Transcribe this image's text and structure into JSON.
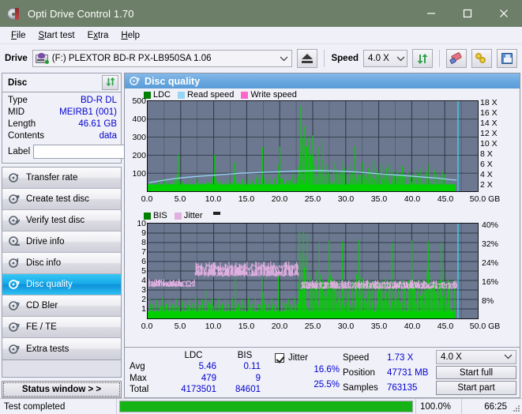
{
  "window": {
    "title": "Opti Drive Control 1.70",
    "app_icon": "disc-icon",
    "minimize": "–",
    "maximize": "□",
    "close": "✕",
    "titlebar_color": "#6d7f68"
  },
  "menu": [
    {
      "label": "File",
      "accel": "F"
    },
    {
      "label": "Start test",
      "accel": "S"
    },
    {
      "label": "Extra",
      "accel": "x"
    },
    {
      "label": "Help",
      "accel": "H"
    }
  ],
  "toolbar": {
    "drive_label": "Drive",
    "drive_value": "(F:)   PLEXTOR BD-R  PX-LB950SA 1.06",
    "eject_icon": "eject-icon",
    "speed_label": "Speed",
    "speed_value": "4.0 X",
    "refresh_icon": "refresh-icon",
    "erase_icon": "eraser-icon",
    "keys_icon": "keys-icon",
    "save_icon": "floppy-save-icon"
  },
  "disc_panel": {
    "title": "Disc",
    "refresh_icon": "refresh-icon",
    "rows": [
      {
        "key": "Type",
        "value": "BD-R DL"
      },
      {
        "key": "MID",
        "value": "MEIRB1 (001)"
      },
      {
        "key": "Length",
        "value": "46.61 GB"
      },
      {
        "key": "Contents",
        "value": "data"
      }
    ],
    "label_key": "Label",
    "label_value": "",
    "label_placeholder": "",
    "disc_icon": "cd-icon"
  },
  "nav": {
    "items": [
      {
        "label": "Transfer rate",
        "icon": "disc-test-icon",
        "active": false
      },
      {
        "label": "Create test disc",
        "icon": "disc-burn-icon",
        "active": false
      },
      {
        "label": "Verify test disc",
        "icon": "disc-verify-icon",
        "active": false
      },
      {
        "label": "Drive info",
        "icon": "drive-info-icon",
        "active": false
      },
      {
        "label": "Disc info",
        "icon": "disc-info-icon",
        "active": false
      },
      {
        "label": "Disc quality",
        "icon": "disc-quality-icon",
        "active": true
      },
      {
        "label": "CD Bler",
        "icon": "cd-bler-icon",
        "active": false
      },
      {
        "label": "FE / TE",
        "icon": "fe-te-icon",
        "active": false
      },
      {
        "label": "Extra tests",
        "icon": "extra-tests-icon",
        "active": false
      }
    ],
    "status_button": "Status window > >"
  },
  "main": {
    "title": "Disc quality",
    "title_icon": "disc-quality-icon"
  },
  "stats": {
    "col_headers": [
      "LDC",
      "BIS"
    ],
    "rows": [
      {
        "label": "Avg",
        "ldc": "5.46",
        "bis": "0.11"
      },
      {
        "label": "Max",
        "ldc": "479",
        "bis": "9"
      },
      {
        "label": "Total",
        "ldc": "4173501",
        "bis": "84601"
      }
    ],
    "jitter": {
      "label": "Jitter",
      "checked": true,
      "avg": "16.6%",
      "max": "25.5%"
    },
    "speed_label": "Speed",
    "speed_value": "1.73 X",
    "position_label": "Position",
    "position_value": "47731 MB",
    "samples_label": "Samples",
    "samples_value": "763135",
    "select_speed": "4.0 X",
    "start_full": "Start full",
    "start_part": "Start part"
  },
  "statusbar": {
    "message": "Test completed",
    "progress_percent": 100.0,
    "progress_text": "100.0%",
    "elapsed": "66:25"
  },
  "chart_data": [
    {
      "id": "top-chart",
      "type": "line",
      "title": "",
      "xlabel": "GB",
      "ylabel": "LDC",
      "y2label": "X",
      "xlim": [
        0,
        50
      ],
      "ylim": [
        0,
        500
      ],
      "y2lim": [
        0,
        18
      ],
      "grid": true,
      "legend_position": "top-left",
      "legend": [
        {
          "name": "LDC",
          "color": "#008000"
        },
        {
          "name": "Read speed",
          "color": "#97d5f2"
        },
        {
          "name": "Write speed",
          "color": "#ff66cc"
        }
      ],
      "xticks": [
        "0.0",
        "5.0",
        "10.0",
        "15.0",
        "20.0",
        "25.0",
        "30.0",
        "35.0",
        "40.0",
        "45.0",
        "50.0 GB"
      ],
      "yticks": [
        100,
        200,
        300,
        400,
        500
      ],
      "y2ticks": [
        "2 X",
        "4 X",
        "6 X",
        "8 X",
        "10 X",
        "12 X",
        "14 X",
        "16 X",
        "18 X"
      ],
      "series": [
        {
          "name": "LDC",
          "color": "#00d000",
          "kind": "spikes",
          "x": [
            0.2,
            0.6,
            1.1,
            1.6,
            2.1,
            2.6,
            3.1,
            3.6,
            4.1,
            4.6,
            4.9,
            5.3,
            5.8,
            6.3,
            6.8,
            7.3,
            7.8,
            8.3,
            8.8,
            9.3,
            9.8,
            10.1,
            10.6,
            11.1,
            11.6,
            12.1,
            12.6,
            13.1,
            13.6,
            13.9,
            14.4,
            14.9,
            15.4,
            15.9,
            16.4,
            16.9,
            17.4,
            17.7,
            18.2,
            18.7,
            19.2,
            19.7,
            20.0,
            20.4,
            20.9,
            21.4,
            21.9,
            22.4,
            22.9,
            23.2,
            23.5,
            23.8,
            24.1,
            24.4,
            24.7,
            25.0,
            25.4,
            25.8,
            26.2,
            26.6,
            27.0,
            27.4,
            27.8,
            28.2,
            28.6,
            29.0,
            29.4,
            29.8,
            30.2,
            30.6,
            31.0,
            31.4,
            31.8,
            32.2,
            32.6,
            33.0,
            33.4,
            33.8,
            34.2,
            34.6,
            35.0,
            35.4,
            35.8,
            36.2,
            36.6,
            37.0,
            37.4,
            37.8,
            38.2,
            38.6,
            39.0,
            39.4,
            39.8,
            40.2,
            40.6,
            41.0,
            41.4,
            41.8,
            42.2,
            42.6,
            43.0,
            43.4,
            43.8,
            44.2,
            44.6,
            45.0,
            45.4,
            45.8,
            46.2,
            46.6
          ],
          "y": [
            40,
            55,
            35,
            60,
            45,
            70,
            50,
            40,
            65,
            205,
            48,
            55,
            42,
            60,
            38,
            70,
            52,
            44,
            60,
            48,
            75,
            203,
            55,
            60,
            45,
            70,
            50,
            160,
            62,
            48,
            70,
            55,
            80,
            60,
            90,
            70,
            245,
            75,
            60,
            88,
            70,
            95,
            248,
            70,
            85,
            60,
            95,
            75,
            140,
            470,
            300,
            360,
            250,
            300,
            200,
            310,
            180,
            250,
            120,
            290,
            150,
            110,
            95,
            160,
            120,
            100,
            170,
            130,
            90,
            150,
            110,
            250,
            120,
            90,
            160,
            100,
            130,
            110,
            170,
            120,
            100,
            150,
            95,
            130,
            160,
            110,
            95,
            120,
            100,
            140,
            90,
            110,
            85,
            95,
            120,
            100,
            130,
            90,
            110,
            150,
            95,
            120,
            100,
            85,
            110,
            95,
            60,
            50,
            40,
            30
          ]
        },
        {
          "name": "Read speed",
          "color": "#97d5f2",
          "kind": "line",
          "x": [
            0.2,
            2.0,
            4.0,
            6.0,
            8.0,
            10.0,
            12.0,
            14.0,
            16.0,
            18.0,
            20.0,
            22.0,
            24.0,
            26.0,
            28.0,
            30.0,
            32.0,
            34.0,
            36.0,
            38.0,
            40.0,
            42.0,
            44.0,
            46.0,
            46.8
          ],
          "y_in_x": [
            1.7,
            2.1,
            2.5,
            2.8,
            3.0,
            3.2,
            3.4,
            3.6,
            3.7,
            3.8,
            3.9,
            4.0,
            4.05,
            4.1,
            4.05,
            3.95,
            3.8,
            3.6,
            3.4,
            3.2,
            3.0,
            2.8,
            2.6,
            2.3,
            2.2
          ]
        },
        {
          "name": "Write speed",
          "color": "#ff66cc",
          "kind": "line",
          "x": [],
          "y": []
        },
        {
          "name": "cursor",
          "color": "#35d2f2",
          "kind": "vline",
          "x": 47.0
        }
      ]
    },
    {
      "id": "bottom-chart",
      "type": "line",
      "title": "",
      "xlabel": "GB",
      "ylabel": "BIS",
      "y2label": "%",
      "xlim": [
        0,
        50
      ],
      "ylim": [
        0,
        10
      ],
      "y2lim": [
        0,
        40
      ],
      "grid": true,
      "legend_position": "top-left",
      "legend": [
        {
          "name": "BIS",
          "color": "#008000"
        },
        {
          "name": "Jitter",
          "color": "#e0afe0"
        }
      ],
      "xticks": [
        "0.0",
        "5.0",
        "10.0",
        "15.0",
        "20.0",
        "25.0",
        "30.0",
        "35.0",
        "40.0",
        "45.0",
        "50.0 GB"
      ],
      "yticks": [
        1,
        2,
        3,
        4,
        5,
        6,
        7,
        8,
        9,
        10
      ],
      "y2ticks": [
        "8%",
        "16%",
        "24%",
        "32%",
        "40%"
      ],
      "series": [
        {
          "name": "BIS",
          "color": "#00d000",
          "kind": "spikes",
          "x": [
            0.3,
            0.8,
            1.3,
            1.8,
            2.3,
            2.8,
            3.3,
            3.8,
            4.3,
            4.8,
            5.3,
            5.8,
            6.3,
            6.8,
            7.3,
            7.8,
            8.3,
            8.8,
            9.3,
            9.8,
            10.3,
            10.8,
            11.3,
            11.8,
            12.3,
            12.8,
            13.3,
            13.8,
            14.3,
            14.8,
            15.3,
            15.8,
            16.3,
            16.8,
            17.3,
            17.8,
            18.3,
            18.8,
            19.3,
            19.8,
            20.3,
            20.8,
            21.3,
            21.8,
            22.3,
            22.8,
            23.0,
            23.3,
            23.6,
            23.9,
            24.2,
            24.6,
            25.0,
            25.5,
            26.0,
            26.5,
            27.0,
            27.5,
            28.0,
            28.5,
            29.0,
            29.5,
            30.0,
            30.5,
            31.0,
            31.5,
            32.0,
            32.5,
            33.0,
            33.5,
            34.0,
            34.5,
            35.0,
            35.5,
            36.0,
            36.5,
            37.0,
            37.5,
            38.0,
            38.5,
            39.0,
            39.5,
            40.0,
            40.5,
            41.0,
            41.5,
            42.0,
            42.5,
            43.0,
            43.5,
            44.0,
            44.5,
            45.0,
            45.5,
            46.0,
            46.5
          ],
          "y": [
            2.1,
            1.5,
            2.0,
            1.4,
            2.2,
            1.6,
            2.0,
            1.5,
            2.1,
            1.4,
            1.9,
            1.5,
            2.0,
            1.6,
            2.2,
            1.5,
            2.0,
            3.0,
            1.6,
            2.1,
            1.5,
            2.2,
            1.6,
            2.0,
            1.5,
            2.1,
            4.2,
            1.6,
            2.0,
            1.5,
            2.2,
            1.6,
            2.1,
            1.5,
            4.4,
            2.0,
            1.6,
            2.2,
            1.5,
            4.6,
            2.0,
            1.6,
            2.1,
            1.5,
            2.2,
            1.6,
            9.2,
            7.0,
            9.1,
            6.5,
            9.0,
            4.5,
            4.0,
            3.9,
            8.0,
            4.0,
            3.8,
            8.2,
            4.2,
            3.9,
            4.0,
            8.1,
            3.8,
            4.1,
            3.9,
            4.0,
            8.3,
            4.2,
            3.8,
            4.0,
            3.9,
            4.1,
            3.8,
            4.0,
            4.2,
            3.9,
            8.0,
            4.0,
            3.8,
            4.1,
            3.9,
            4.0,
            8.2,
            3.8,
            4.1,
            3.9,
            4.0,
            8.1,
            4.2,
            3.8,
            4.0,
            8.0,
            3.9,
            4.1,
            3.8,
            4.0
          ]
        },
        {
          "name": "Jitter",
          "color": "#e0afe0",
          "kind": "band",
          "segments": [
            {
              "x0": 0.2,
              "x1": 7.2,
              "lo": 3.3,
              "hi": 4.3,
              "note": "about 13-17%"
            },
            {
              "x0": 7.2,
              "x1": 22.8,
              "lo": 4.4,
              "hi": 6.3,
              "note": "about 18-25%"
            },
            {
              "x0": 23.2,
              "x1": 46.8,
              "lo": 3.1,
              "hi": 4.2,
              "note": "about 12-17%"
            }
          ]
        },
        {
          "name": "cursor",
          "color": "#35d2f2",
          "kind": "vline",
          "x": 47.0
        }
      ]
    }
  ]
}
